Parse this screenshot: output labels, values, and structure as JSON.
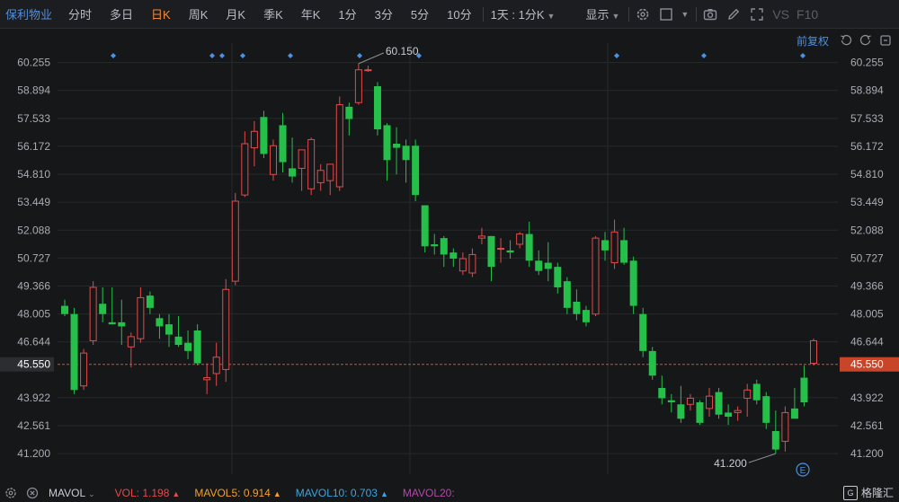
{
  "toolbar": {
    "stock_name": "保利物业",
    "tabs": [
      {
        "label": "分时",
        "active": false
      },
      {
        "label": "多日",
        "active": false
      },
      {
        "label": "日K",
        "active": true
      },
      {
        "label": "周K",
        "active": false
      },
      {
        "label": "月K",
        "active": false
      },
      {
        "label": "季K",
        "active": false
      },
      {
        "label": "年K",
        "active": false
      },
      {
        "label": "1分",
        "active": false
      },
      {
        "label": "3分",
        "active": false
      },
      {
        "label": "5分",
        "active": false
      },
      {
        "label": "10分",
        "active": false
      }
    ],
    "period_dropdown": "1天 : 1分K",
    "display_label": "显示",
    "vs_label": "VS",
    "f10_label": "F10"
  },
  "subbar": {
    "restore_label": "前复权"
  },
  "colors": {
    "up": "#e24b4b",
    "down": "#25c04a",
    "accent": "#f08c3a",
    "link": "#4f8fe0",
    "price_line": "#d8502c"
  },
  "icons": {
    "settings": "gear-icon",
    "window": "square-icon",
    "camera": "camera-icon",
    "draw": "pencil-icon",
    "fullscreen": "expand-icon",
    "undo": "undo-icon",
    "redo": "redo-icon",
    "fit": "fit-icon",
    "close": "close-icon"
  },
  "chart_data": {
    "type": "candlestick",
    "y_ticks": [
      "60.255",
      "58.894",
      "57.533",
      "56.172",
      "54.810",
      "53.449",
      "52.088",
      "50.727",
      "49.366",
      "48.005",
      "46.644",
      "45.550",
      "43.922",
      "42.561",
      "41.200"
    ],
    "ylim": [
      40.2,
      61.2
    ],
    "current_price": "45.550",
    "max_label": "60.150",
    "min_label": "41.200",
    "event_marker": "E",
    "candles": [
      {
        "o": 48.4,
        "h": 48.7,
        "l": 47.9,
        "c": 48.0
      },
      {
        "o": 48.0,
        "h": 48.3,
        "l": 44.1,
        "c": 44.3
      },
      {
        "o": 44.5,
        "h": 46.3,
        "l": 44.3,
        "c": 46.1
      },
      {
        "o": 46.7,
        "h": 49.6,
        "l": 46.5,
        "c": 49.3
      },
      {
        "o": 48.5,
        "h": 49.3,
        "l": 47.6,
        "c": 48.0
      },
      {
        "o": 47.6,
        "h": 49.3,
        "l": 47.5,
        "c": 47.5
      },
      {
        "o": 47.6,
        "h": 48.7,
        "l": 46.5,
        "c": 47.4
      },
      {
        "o": 46.4,
        "h": 47.1,
        "l": 45.4,
        "c": 46.9
      },
      {
        "o": 46.8,
        "h": 49.3,
        "l": 46.6,
        "c": 48.8
      },
      {
        "o": 48.9,
        "h": 49.1,
        "l": 48.0,
        "c": 48.3
      },
      {
        "o": 47.8,
        "h": 48.0,
        "l": 46.8,
        "c": 47.4
      },
      {
        "o": 47.5,
        "h": 48.0,
        "l": 46.4,
        "c": 47.0
      },
      {
        "o": 46.9,
        "h": 47.9,
        "l": 46.4,
        "c": 46.5
      },
      {
        "o": 46.6,
        "h": 47.2,
        "l": 45.8,
        "c": 46.2
      },
      {
        "o": 47.2,
        "h": 47.5,
        "l": 45.5,
        "c": 45.6
      },
      {
        "o": 44.8,
        "h": 45.6,
        "l": 44.1,
        "c": 44.9
      },
      {
        "o": 45.1,
        "h": 46.6,
        "l": 44.5,
        "c": 45.9
      },
      {
        "o": 45.3,
        "h": 49.7,
        "l": 44.7,
        "c": 49.2
      },
      {
        "o": 49.6,
        "h": 53.9,
        "l": 49.4,
        "c": 53.5
      },
      {
        "o": 53.8,
        "h": 56.9,
        "l": 53.7,
        "c": 56.3
      },
      {
        "o": 56.1,
        "h": 57.4,
        "l": 55.2,
        "c": 56.9
      },
      {
        "o": 57.6,
        "h": 57.9,
        "l": 55.6,
        "c": 55.8
      },
      {
        "o": 54.8,
        "h": 56.5,
        "l": 54.5,
        "c": 56.2
      },
      {
        "o": 57.2,
        "h": 57.8,
        "l": 54.9,
        "c": 55.4
      },
      {
        "o": 55.1,
        "h": 56.6,
        "l": 54.4,
        "c": 54.7
      },
      {
        "o": 55.1,
        "h": 56.0,
        "l": 54.0,
        "c": 56.0
      },
      {
        "o": 54.1,
        "h": 56.6,
        "l": 53.8,
        "c": 56.5
      },
      {
        "o": 54.4,
        "h": 55.3,
        "l": 54.0,
        "c": 55.0
      },
      {
        "o": 54.5,
        "h": 55.3,
        "l": 53.8,
        "c": 55.3
      },
      {
        "o": 54.2,
        "h": 58.6,
        "l": 54.0,
        "c": 58.2
      },
      {
        "o": 58.1,
        "h": 58.3,
        "l": 56.7,
        "c": 57.5
      },
      {
        "o": 58.3,
        "h": 60.2,
        "l": 58.2,
        "c": 59.9
      },
      {
        "o": 59.9,
        "h": 60.1,
        "l": 59.8,
        "c": 59.9
      },
      {
        "o": 59.1,
        "h": 59.3,
        "l": 56.7,
        "c": 57.0
      },
      {
        "o": 57.2,
        "h": 57.3,
        "l": 54.5,
        "c": 55.5
      },
      {
        "o": 56.3,
        "h": 57.1,
        "l": 54.8,
        "c": 56.1
      },
      {
        "o": 56.2,
        "h": 56.5,
        "l": 54.4,
        "c": 55.5
      },
      {
        "o": 56.2,
        "h": 56.5,
        "l": 53.5,
        "c": 53.8
      },
      {
        "o": 53.3,
        "h": 53.3,
        "l": 51.0,
        "c": 51.3
      },
      {
        "o": 51.4,
        "h": 51.9,
        "l": 50.9,
        "c": 51.3
      },
      {
        "o": 51.7,
        "h": 51.8,
        "l": 50.3,
        "c": 50.9
      },
      {
        "o": 51.0,
        "h": 51.2,
        "l": 50.3,
        "c": 50.7
      },
      {
        "o": 50.1,
        "h": 51.0,
        "l": 49.9,
        "c": 50.7
      },
      {
        "o": 50.0,
        "h": 51.2,
        "l": 49.8,
        "c": 50.9
      },
      {
        "o": 51.7,
        "h": 52.2,
        "l": 51.4,
        "c": 51.8
      },
      {
        "o": 51.8,
        "h": 51.8,
        "l": 49.6,
        "c": 50.3
      },
      {
        "o": 51.2,
        "h": 51.7,
        "l": 50.5,
        "c": 51.2
      },
      {
        "o": 51.1,
        "h": 51.6,
        "l": 50.7,
        "c": 51.0
      },
      {
        "o": 51.4,
        "h": 52.0,
        "l": 51.2,
        "c": 51.9
      },
      {
        "o": 51.9,
        "h": 52.5,
        "l": 50.3,
        "c": 50.6
      },
      {
        "o": 50.6,
        "h": 51.1,
        "l": 49.9,
        "c": 50.1
      },
      {
        "o": 50.5,
        "h": 51.5,
        "l": 49.6,
        "c": 50.2
      },
      {
        "o": 50.3,
        "h": 50.5,
        "l": 49.0,
        "c": 49.3
      },
      {
        "o": 49.6,
        "h": 49.8,
        "l": 48.0,
        "c": 48.3
      },
      {
        "o": 48.6,
        "h": 49.2,
        "l": 47.7,
        "c": 48.0
      },
      {
        "o": 48.2,
        "h": 48.4,
        "l": 47.4,
        "c": 47.6
      },
      {
        "o": 48.0,
        "h": 51.8,
        "l": 47.9,
        "c": 51.7
      },
      {
        "o": 51.6,
        "h": 52.0,
        "l": 50.6,
        "c": 51.1
      },
      {
        "o": 50.5,
        "h": 52.6,
        "l": 50.2,
        "c": 52.0
      },
      {
        "o": 51.6,
        "h": 52.2,
        "l": 50.4,
        "c": 50.5
      },
      {
        "o": 50.6,
        "h": 50.8,
        "l": 48.0,
        "c": 48.4
      },
      {
        "o": 48.0,
        "h": 48.3,
        "l": 45.9,
        "c": 46.2
      },
      {
        "o": 46.2,
        "h": 46.4,
        "l": 44.8,
        "c": 45.0
      },
      {
        "o": 44.4,
        "h": 45.0,
        "l": 43.6,
        "c": 43.9
      },
      {
        "o": 43.8,
        "h": 44.1,
        "l": 43.2,
        "c": 43.7
      },
      {
        "o": 43.6,
        "h": 44.5,
        "l": 42.7,
        "c": 42.9
      },
      {
        "o": 43.6,
        "h": 44.1,
        "l": 43.3,
        "c": 43.9
      },
      {
        "o": 43.7,
        "h": 43.8,
        "l": 42.6,
        "c": 42.7
      },
      {
        "o": 43.4,
        "h": 44.4,
        "l": 43.0,
        "c": 44.0
      },
      {
        "o": 44.2,
        "h": 44.4,
        "l": 42.9,
        "c": 43.1
      },
      {
        "o": 43.2,
        "h": 43.6,
        "l": 42.6,
        "c": 43.0
      },
      {
        "o": 43.2,
        "h": 43.5,
        "l": 42.8,
        "c": 43.3
      },
      {
        "o": 43.9,
        "h": 44.6,
        "l": 43.0,
        "c": 44.3
      },
      {
        "o": 44.6,
        "h": 44.8,
        "l": 43.6,
        "c": 43.8
      },
      {
        "o": 44.0,
        "h": 44.2,
        "l": 42.4,
        "c": 42.7
      },
      {
        "o": 42.3,
        "h": 43.3,
        "l": 41.2,
        "c": 41.4
      },
      {
        "o": 41.8,
        "h": 43.5,
        "l": 41.3,
        "c": 43.2
      },
      {
        "o": 43.4,
        "h": 44.4,
        "l": 43.0,
        "c": 42.9
      },
      {
        "o": 44.9,
        "h": 45.5,
        "l": 43.5,
        "c": 43.7
      },
      {
        "o": 45.6,
        "h": 46.8,
        "l": 45.5,
        "c": 46.7
      }
    ]
  },
  "footer": {
    "indicator": "MAVOL",
    "vol_label": "VOL:",
    "vol_value": "1.198",
    "mavol5_label": "MAVOL5:",
    "mavol5_value": "0.914",
    "mavol10_label": "MAVOL10:",
    "mavol10_value": "0.703",
    "mavol20_label": "MAVOL20:",
    "logo_text": "格隆汇"
  }
}
